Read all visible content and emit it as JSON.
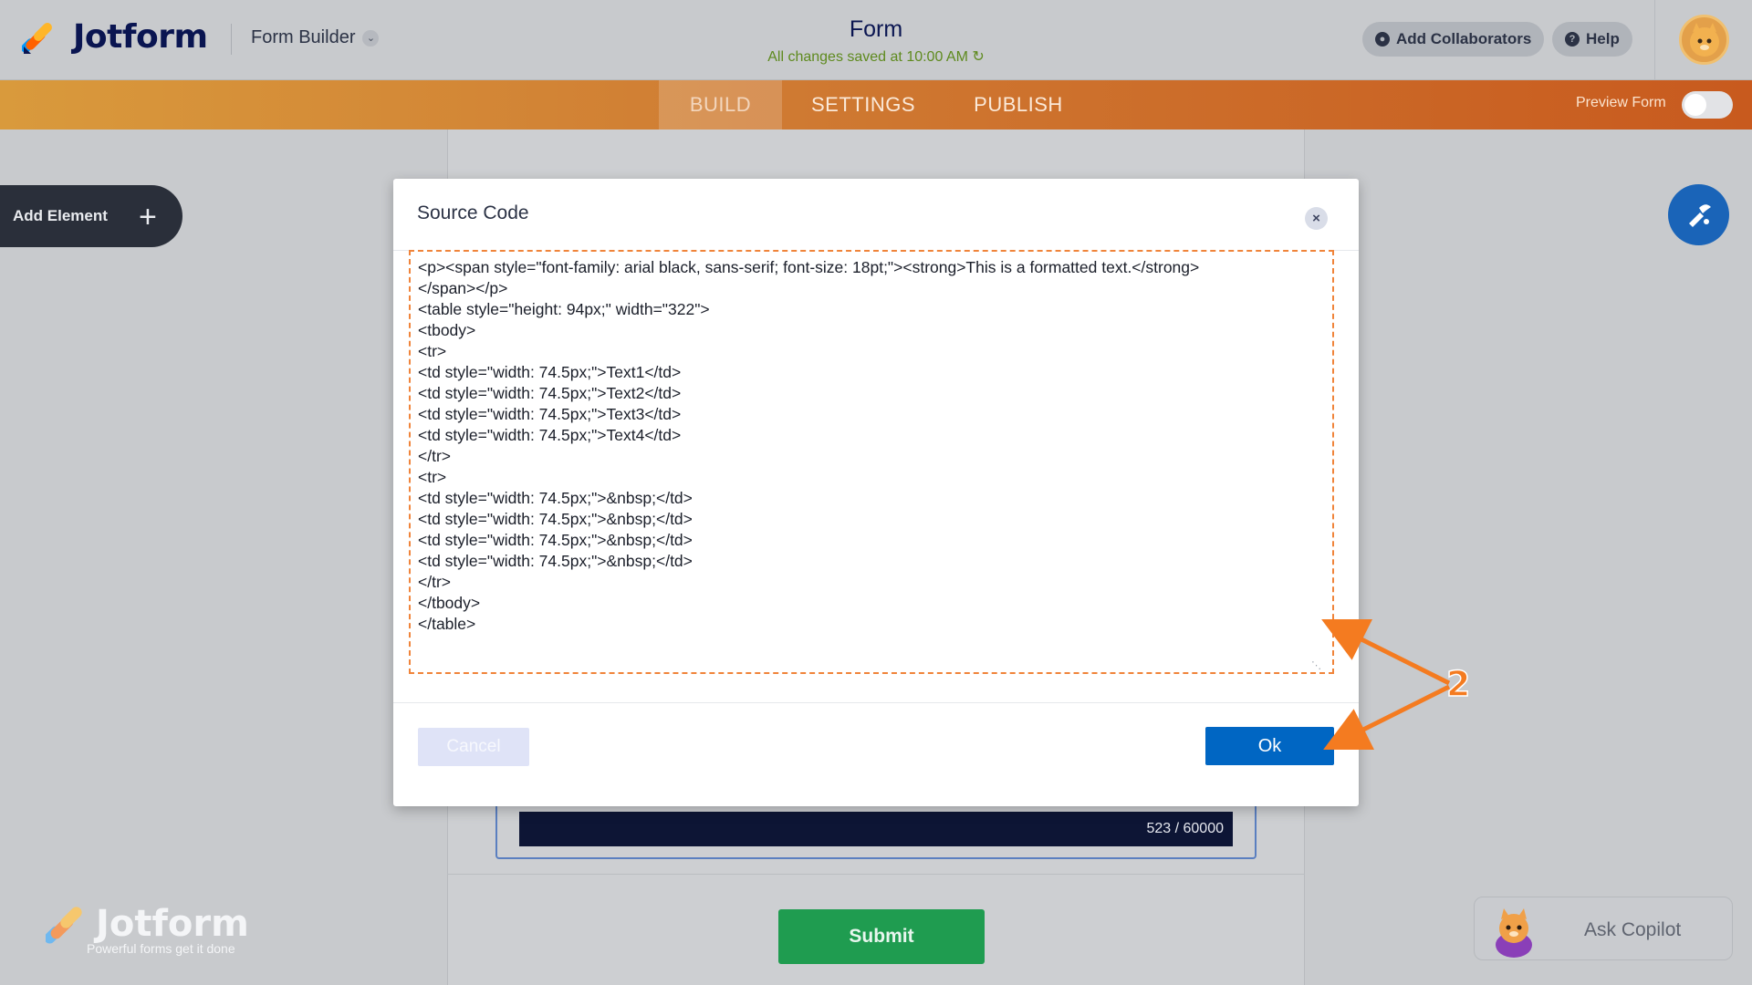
{
  "header": {
    "brand": "Jotform",
    "builder_menu": "Form Builder",
    "form_title": "Form",
    "saved_status": "All changes saved at 10:00 AM",
    "add_collaborators": "Add Collaborators",
    "help": "Help"
  },
  "nav": {
    "tabs": [
      {
        "label": "BUILD",
        "active": true
      },
      {
        "label": "SETTINGS",
        "active": false
      },
      {
        "label": "PUBLISH",
        "active": false
      }
    ],
    "preview_label": "Preview Form",
    "preview_on": false
  },
  "sidebar": {
    "add_element": "Add Element"
  },
  "form": {
    "char_counter": "523 / 60000",
    "submit_label": "Submit"
  },
  "footer": {
    "logo_word": "Jotform",
    "tagline": "Powerful forms get it done",
    "copilot_label": "Ask Copilot"
  },
  "modal": {
    "title": "Source Code",
    "code": "<p><span style=\"font-family: arial black, sans-serif; font-size: 18pt;\"><strong>This is a formatted text.</strong>\n</span></p>\n<table style=\"height: 94px;\" width=\"322\">\n<tbody>\n<tr>\n<td style=\"width: 74.5px;\">Text1</td>\n<td style=\"width: 74.5px;\">Text2</td>\n<td style=\"width: 74.5px;\">Text3</td>\n<td style=\"width: 74.5px;\">Text4</td>\n</tr>\n<tr>\n<td style=\"width: 74.5px;\">&nbsp;</td>\n<td style=\"width: 74.5px;\">&nbsp;</td>\n<td style=\"width: 74.5px;\">&nbsp;</td>\n<td style=\"width: 74.5px;\">&nbsp;</td>\n</tr>\n</tbody>\n</table>",
    "cancel_label": "Cancel",
    "ok_label": "Ok"
  },
  "annotation": {
    "step_number": "2"
  },
  "colors": {
    "brand_navy": "#0a1551",
    "accent_orange": "#f0843a",
    "ok_blue": "#0066c3",
    "submit_green": "#1f9c50"
  }
}
